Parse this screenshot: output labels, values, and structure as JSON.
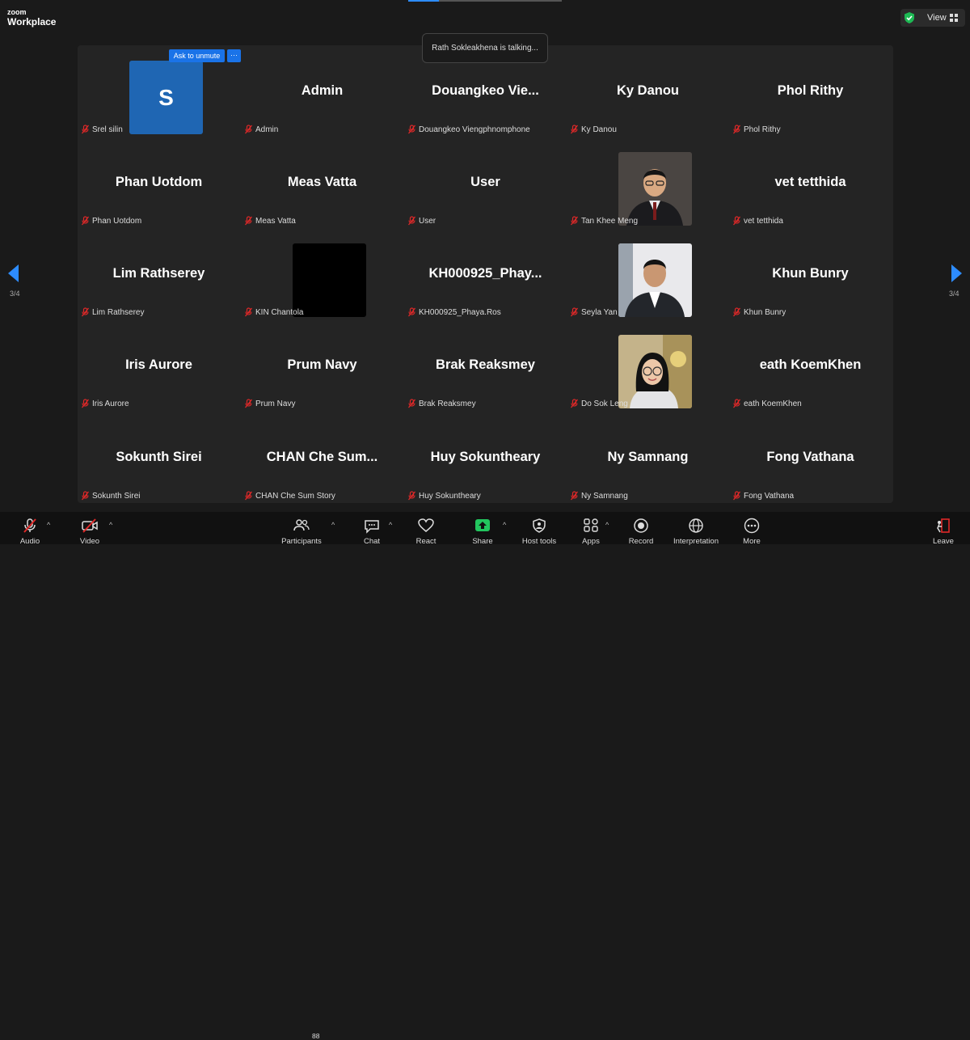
{
  "app": {
    "logo_small": "zoom",
    "logo_big": "Workplace",
    "view_label": "View"
  },
  "toast": "Rath Sokleakhena is talking...",
  "ask_unmute": "Ask to unmute",
  "more_dots": "···",
  "page_indicator": "3/4",
  "tiles": [
    {
      "name": "",
      "label": "Srel silin",
      "avatar": "S"
    },
    {
      "name": "Admin",
      "label": "Admin"
    },
    {
      "name": "Douangkeo  Vie...",
      "label": "Douangkeo Viengphnomphone"
    },
    {
      "name": "Ky Danou",
      "label": "Ky Danou"
    },
    {
      "name": "Phol Rithy",
      "label": "Phol Rithy"
    },
    {
      "name": "Phan Uotdom",
      "label": "Phan Uotdom"
    },
    {
      "name": "Meas Vatta",
      "label": "Meas Vatta"
    },
    {
      "name": "User",
      "label": "User"
    },
    {
      "name": "",
      "label": "Tan Khee Meng",
      "video": "man-glasses"
    },
    {
      "name": "vet tetthida",
      "label": "vet tetthida"
    },
    {
      "name": "Lim Rathserey",
      "label": "Lim Rathserey"
    },
    {
      "name": "",
      "label": "KIN Chantola",
      "video": "black"
    },
    {
      "name": "KH000925_Phay...",
      "label": "KH000925_Phaya.Ros"
    },
    {
      "name": "",
      "label": "Seyla Yan",
      "video": "man-suit"
    },
    {
      "name": "Khun Bunry",
      "label": "Khun Bunry"
    },
    {
      "name": "Iris Aurore",
      "label": "Iris Aurore"
    },
    {
      "name": "Prum Navy",
      "label": "Prum Navy"
    },
    {
      "name": "Brak Reaksmey",
      "label": "Brak Reaksmey"
    },
    {
      "name": "",
      "label": "Do Sok Leng",
      "video": "woman-glasses"
    },
    {
      "name": "eath KoemKhen",
      "label": "eath KoemKhen"
    },
    {
      "name": "Sokunth Sirei",
      "label": "Sokunth Sirei"
    },
    {
      "name": "CHAN  Che  Sum...",
      "label": "CHAN Che Sum Story"
    },
    {
      "name": "Huy Sokuntheary",
      "label": "Huy Sokuntheary"
    },
    {
      "name": "Ny Samnang",
      "label": "Ny Samnang"
    },
    {
      "name": "Fong Vathana",
      "label": "Fong Vathana"
    }
  ],
  "toolbar": {
    "audio": "Audio",
    "video": "Video",
    "participants": "Participants",
    "participants_count": "88",
    "chat": "Chat",
    "react": "React",
    "share": "Share",
    "host_tools": "Host tools",
    "apps": "Apps",
    "record": "Record",
    "interpretation": "Interpretation",
    "more": "More",
    "leave": "Leave"
  },
  "colors": {
    "accent": "#2d8cff",
    "share_green": "#22c55e",
    "muted_red": "#e02828",
    "shield_green": "#1db954"
  }
}
